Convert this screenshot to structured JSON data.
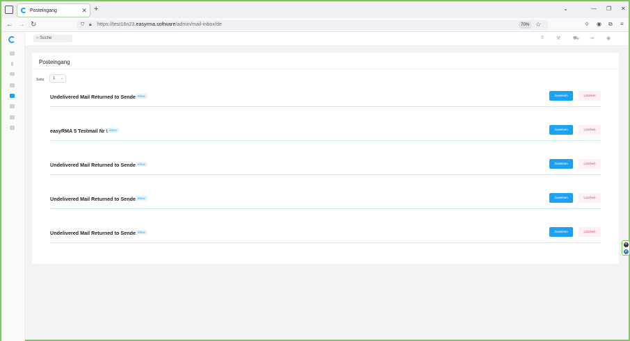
{
  "browser": {
    "tab_title": "Posteingang",
    "tab_close": "✕",
    "new_tab": "+",
    "url_prefix": "https://test16n23.",
    "url_domain": "easyrma.software",
    "url_path": "/admin/mail-inbox/de",
    "zoom": "70%"
  },
  "appbar": {
    "search_placeholder": "Suche"
  },
  "panel": {
    "title": "Posteingang",
    "page_label": "Seite",
    "page_value": "1"
  },
  "mails": [
    {
      "subject": "Undelivered Mail Returned to Sender",
      "badge": "inbox",
      "assign_label": "Zuweisen",
      "delete_label": "Löschen"
    },
    {
      "subject": "easyRMA 5 Testmail Nr 5",
      "badge": "inbox",
      "assign_label": "Zuweisen",
      "delete_label": "Löschen"
    },
    {
      "subject": "Undelivered Mail Returned to Sender",
      "badge": "inbox",
      "assign_label": "Zuweisen",
      "delete_label": "Löschen"
    },
    {
      "subject": "Undelivered Mail Returned to Sender",
      "badge": "inbox",
      "assign_label": "Zuweisen",
      "delete_label": "Löschen"
    },
    {
      "subject": "Undelivered Mail Returned to Sender",
      "badge": "inbox",
      "assign_label": "Zuweisen",
      "delete_label": "Löschen"
    }
  ],
  "colors": {
    "accent": "#1da1f2",
    "delete_text": "#d63b6e",
    "frame": "#7ecb5a"
  }
}
